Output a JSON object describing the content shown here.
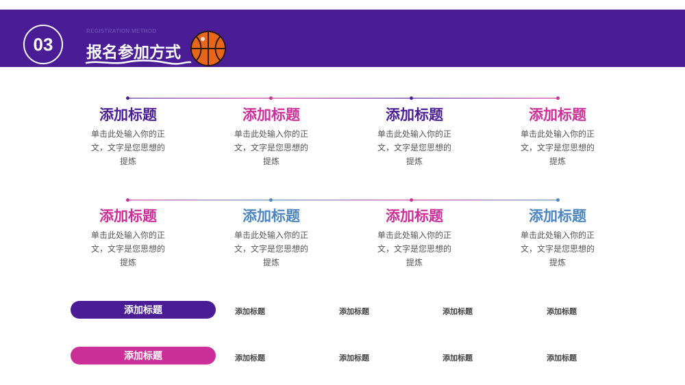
{
  "header": {
    "number": "03",
    "subtitle_en": "REGISTRATION METHOD",
    "title": "报名参加方式"
  },
  "colors": {
    "purple": "#4a1d96",
    "magenta": "#cc2f98",
    "blue": "#4b86c0"
  },
  "icons": [
    "basketball-icon"
  ],
  "grid": [
    {
      "title": "添加标题",
      "body": "单击此处输入你的正文，文字是您思想的提炼",
      "color": "#4a1d96"
    },
    {
      "title": "添加标题",
      "body": "单击此处输入你的正文，文字是您思想的提炼",
      "color": "#cc2f98"
    },
    {
      "title": "添加标题",
      "body": "单击此处输入你的正文，文字是您思想的提炼",
      "color": "#4a1d96"
    },
    {
      "title": "添加标题",
      "body": "单击此处输入你的正文，文字是您思想的提炼",
      "color": "#cc2f98"
    },
    {
      "title": "添加标题",
      "body": "单击此处输入你的正文，文字是您思想的提炼",
      "color": "#cc2f98"
    },
    {
      "title": "添加标题",
      "body": "单击此处输入你的正文，文字是您思想的提炼",
      "color": "#4b86c0"
    },
    {
      "title": "添加标题",
      "body": "单击此处输入你的正文，文字是您思想的提炼",
      "color": "#cc2f98"
    },
    {
      "title": "添加标题",
      "body": "单击此处输入你的正文，文字是您思想的提炼",
      "color": "#4b86c0"
    }
  ],
  "table_rows": [
    {
      "label": "添加标题",
      "color": "#4a1d96",
      "cells": [
        "添加标题",
        "添加标题",
        "添加标题",
        "添加标题"
      ]
    },
    {
      "label": "添加标题",
      "color": "#cc2f98",
      "cells": [
        "添加标题",
        "添加标题",
        "添加标题",
        "添加标题"
      ]
    }
  ]
}
